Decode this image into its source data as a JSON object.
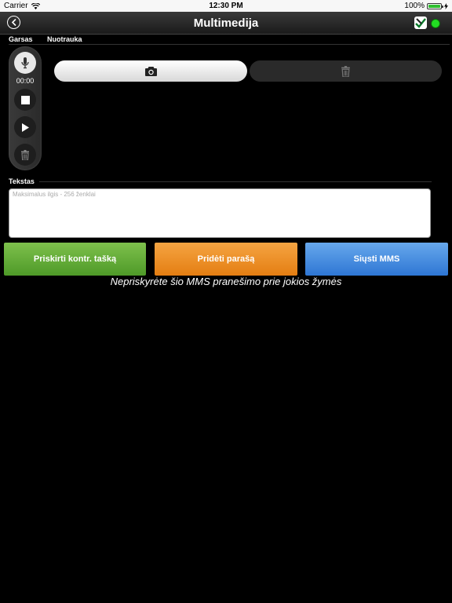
{
  "status_bar": {
    "carrier": "Carrier",
    "time": "12:30 PM",
    "battery": "100%"
  },
  "nav": {
    "title": "Multimedija"
  },
  "audio": {
    "label": "Garsas",
    "timer": "00:00"
  },
  "photo": {
    "label": "Nuotrauka"
  },
  "text": {
    "label": "Tekstas",
    "placeholder": "Maksimalus ilgis - 256 ženklai",
    "value": ""
  },
  "buttons": {
    "assign": "Priskirti kontr. tašką",
    "signature": "Pridėti parašą",
    "send": "Siųsti MMS"
  },
  "message": "Nepriskyrėte šio MMS pranešimo prie jokios žymės",
  "colors": {
    "green": "#5fae35",
    "orange": "#ee9225",
    "blue": "#4a8fe0",
    "status_dot": "#22dd22"
  },
  "icons": [
    "wifi-icon",
    "battery-icon",
    "back-icon",
    "sync-icon",
    "status-dot-icon",
    "microphone-icon",
    "stop-icon",
    "play-icon",
    "trash-icon",
    "camera-icon"
  ]
}
